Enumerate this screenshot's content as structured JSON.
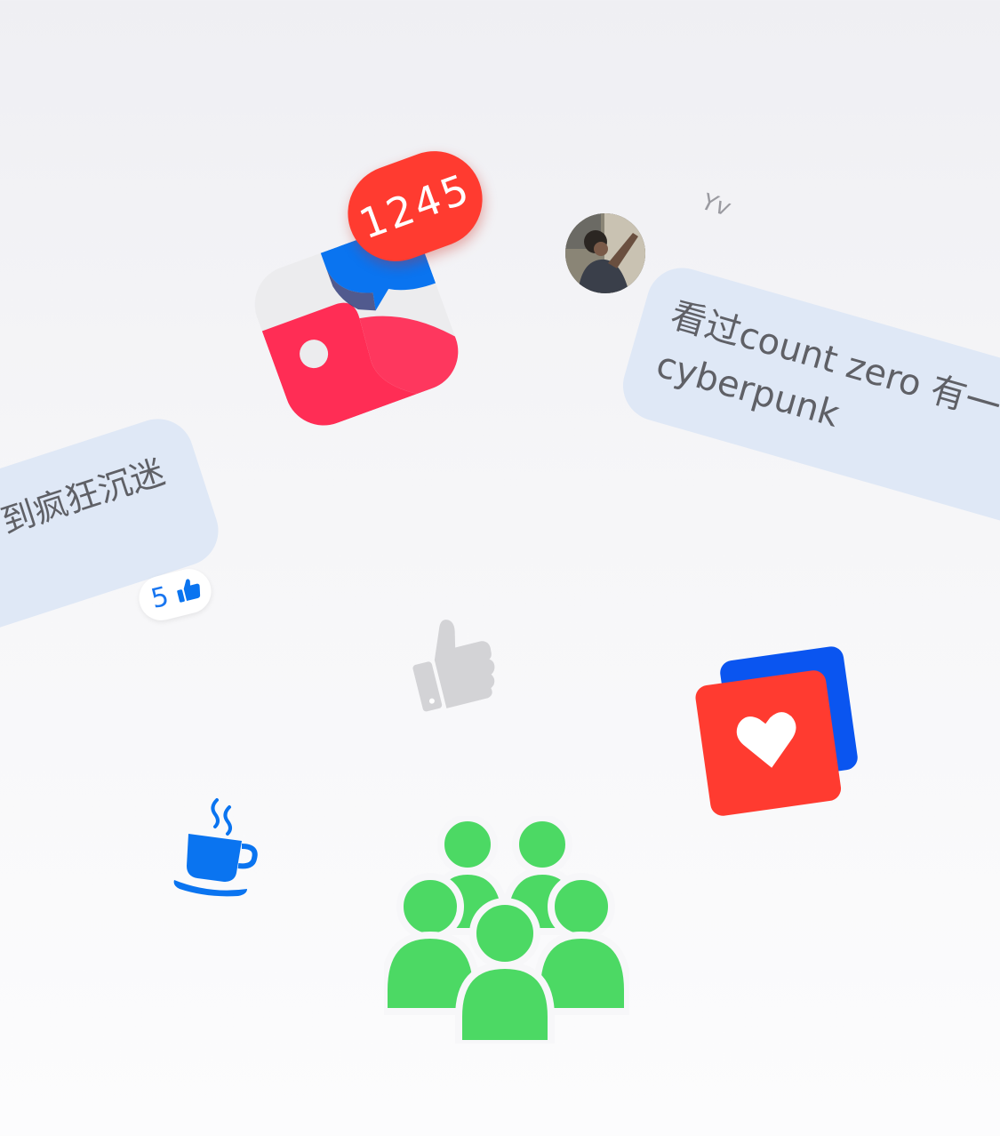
{
  "notification": {
    "badge_count": "1245"
  },
  "comment": {
    "username": "Yv",
    "text": "看过count zero 有一\ncyberpunk",
    "avatar_icon": "avatar-photo"
  },
  "left_comment": {
    "text": "到疯狂沉迷",
    "like_count": "5",
    "like_icon": "thumbs-up-icon"
  },
  "icons": {
    "app": "chat-app-icon",
    "thumb": "thumbs-up-icon",
    "cards": "heart-cards-icon",
    "coffee": "coffee-cup-icon",
    "group": "group-people-icon"
  },
  "colors": {
    "badge": "#ff3b30",
    "bubble": "#dfe8f6",
    "blue": "#0a74f0",
    "red": "#ff3b30",
    "pink": "#ff2d55",
    "green": "#4cd964",
    "gray": "#d3d3d6"
  }
}
